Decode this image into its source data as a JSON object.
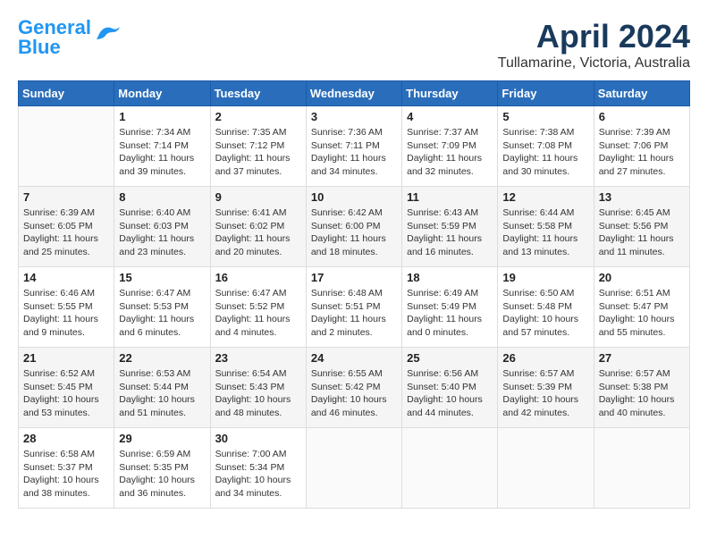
{
  "logo": {
    "line1": "General",
    "line2": "Blue"
  },
  "title": "April 2024",
  "subtitle": "Tullamarine, Victoria, Australia",
  "days_header": [
    "Sunday",
    "Monday",
    "Tuesday",
    "Wednesday",
    "Thursday",
    "Friday",
    "Saturday"
  ],
  "weeks": [
    [
      {
        "day": "",
        "info": ""
      },
      {
        "day": "1",
        "info": "Sunrise: 7:34 AM\nSunset: 7:14 PM\nDaylight: 11 hours\nand 39 minutes."
      },
      {
        "day": "2",
        "info": "Sunrise: 7:35 AM\nSunset: 7:12 PM\nDaylight: 11 hours\nand 37 minutes."
      },
      {
        "day": "3",
        "info": "Sunrise: 7:36 AM\nSunset: 7:11 PM\nDaylight: 11 hours\nand 34 minutes."
      },
      {
        "day": "4",
        "info": "Sunrise: 7:37 AM\nSunset: 7:09 PM\nDaylight: 11 hours\nand 32 minutes."
      },
      {
        "day": "5",
        "info": "Sunrise: 7:38 AM\nSunset: 7:08 PM\nDaylight: 11 hours\nand 30 minutes."
      },
      {
        "day": "6",
        "info": "Sunrise: 7:39 AM\nSunset: 7:06 PM\nDaylight: 11 hours\nand 27 minutes."
      }
    ],
    [
      {
        "day": "7",
        "info": "Sunrise: 6:39 AM\nSunset: 6:05 PM\nDaylight: 11 hours\nand 25 minutes."
      },
      {
        "day": "8",
        "info": "Sunrise: 6:40 AM\nSunset: 6:03 PM\nDaylight: 11 hours\nand 23 minutes."
      },
      {
        "day": "9",
        "info": "Sunrise: 6:41 AM\nSunset: 6:02 PM\nDaylight: 11 hours\nand 20 minutes."
      },
      {
        "day": "10",
        "info": "Sunrise: 6:42 AM\nSunset: 6:00 PM\nDaylight: 11 hours\nand 18 minutes."
      },
      {
        "day": "11",
        "info": "Sunrise: 6:43 AM\nSunset: 5:59 PM\nDaylight: 11 hours\nand 16 minutes."
      },
      {
        "day": "12",
        "info": "Sunrise: 6:44 AM\nSunset: 5:58 PM\nDaylight: 11 hours\nand 13 minutes."
      },
      {
        "day": "13",
        "info": "Sunrise: 6:45 AM\nSunset: 5:56 PM\nDaylight: 11 hours\nand 11 minutes."
      }
    ],
    [
      {
        "day": "14",
        "info": "Sunrise: 6:46 AM\nSunset: 5:55 PM\nDaylight: 11 hours\nand 9 minutes."
      },
      {
        "day": "15",
        "info": "Sunrise: 6:47 AM\nSunset: 5:53 PM\nDaylight: 11 hours\nand 6 minutes."
      },
      {
        "day": "16",
        "info": "Sunrise: 6:47 AM\nSunset: 5:52 PM\nDaylight: 11 hours\nand 4 minutes."
      },
      {
        "day": "17",
        "info": "Sunrise: 6:48 AM\nSunset: 5:51 PM\nDaylight: 11 hours\nand 2 minutes."
      },
      {
        "day": "18",
        "info": "Sunrise: 6:49 AM\nSunset: 5:49 PM\nDaylight: 11 hours\nand 0 minutes."
      },
      {
        "day": "19",
        "info": "Sunrise: 6:50 AM\nSunset: 5:48 PM\nDaylight: 10 hours\nand 57 minutes."
      },
      {
        "day": "20",
        "info": "Sunrise: 6:51 AM\nSunset: 5:47 PM\nDaylight: 10 hours\nand 55 minutes."
      }
    ],
    [
      {
        "day": "21",
        "info": "Sunrise: 6:52 AM\nSunset: 5:45 PM\nDaylight: 10 hours\nand 53 minutes."
      },
      {
        "day": "22",
        "info": "Sunrise: 6:53 AM\nSunset: 5:44 PM\nDaylight: 10 hours\nand 51 minutes."
      },
      {
        "day": "23",
        "info": "Sunrise: 6:54 AM\nSunset: 5:43 PM\nDaylight: 10 hours\nand 48 minutes."
      },
      {
        "day": "24",
        "info": "Sunrise: 6:55 AM\nSunset: 5:42 PM\nDaylight: 10 hours\nand 46 minutes."
      },
      {
        "day": "25",
        "info": "Sunrise: 6:56 AM\nSunset: 5:40 PM\nDaylight: 10 hours\nand 44 minutes."
      },
      {
        "day": "26",
        "info": "Sunrise: 6:57 AM\nSunset: 5:39 PM\nDaylight: 10 hours\nand 42 minutes."
      },
      {
        "day": "27",
        "info": "Sunrise: 6:57 AM\nSunset: 5:38 PM\nDaylight: 10 hours\nand 40 minutes."
      }
    ],
    [
      {
        "day": "28",
        "info": "Sunrise: 6:58 AM\nSunset: 5:37 PM\nDaylight: 10 hours\nand 38 minutes."
      },
      {
        "day": "29",
        "info": "Sunrise: 6:59 AM\nSunset: 5:35 PM\nDaylight: 10 hours\nand 36 minutes."
      },
      {
        "day": "30",
        "info": "Sunrise: 7:00 AM\nSunset: 5:34 PM\nDaylight: 10 hours\nand 34 minutes."
      },
      {
        "day": "",
        "info": ""
      },
      {
        "day": "",
        "info": ""
      },
      {
        "day": "",
        "info": ""
      },
      {
        "day": "",
        "info": ""
      }
    ]
  ]
}
